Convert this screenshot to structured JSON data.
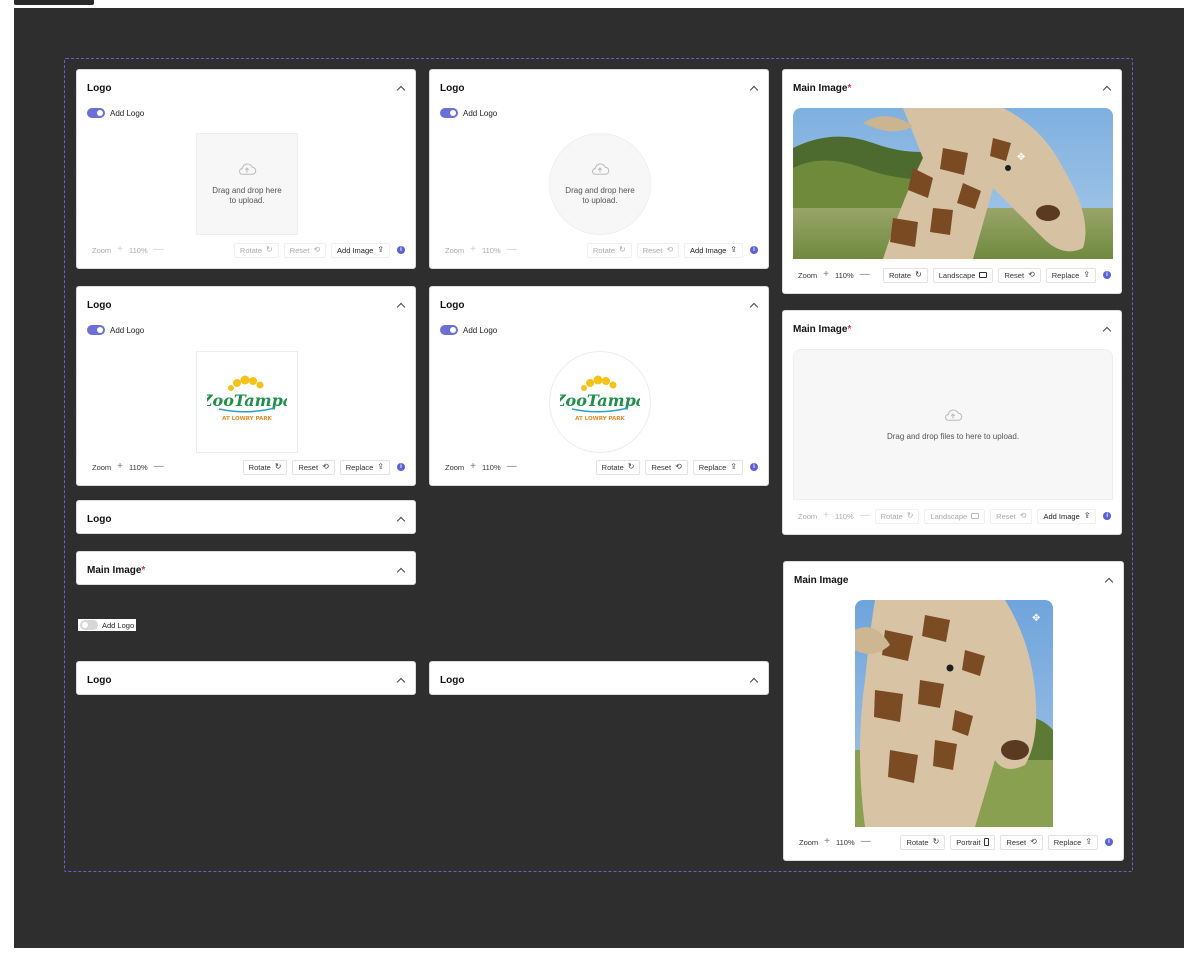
{
  "labels": {
    "logo": "Logo",
    "main_image": "Main Image",
    "required": "*",
    "add_logo": "Add Logo",
    "zoom": "Zoom",
    "zoom_value": "110%",
    "rotate": "Rotate",
    "reset": "Reset",
    "add_image": "Add Image",
    "replace": "Replace",
    "landscape": "Landscape",
    "portrait": "Portrait",
    "drag_line1": "Drag and drop here",
    "drag_line2": "to upload.",
    "drag_files": "Drag and drop files to here to upload.",
    "info": "i",
    "plus": "+",
    "minus": "—",
    "logo_brand_main": "ZooTampa",
    "logo_brand_sub": "AT LOWRY PARK"
  },
  "colors": {
    "accent": "#5b61d6",
    "toggle_on": "#6c6fd8",
    "required": "#e0314a",
    "canvas": "#2e2e2e",
    "frame_border": "#6b5fc4"
  },
  "icons": [
    "chevron-up-icon",
    "cloud-upload-icon",
    "rotate-icon",
    "reset-icon",
    "upload-icon",
    "info-icon",
    "landscape-icon",
    "portrait-icon",
    "move-icon"
  ]
}
